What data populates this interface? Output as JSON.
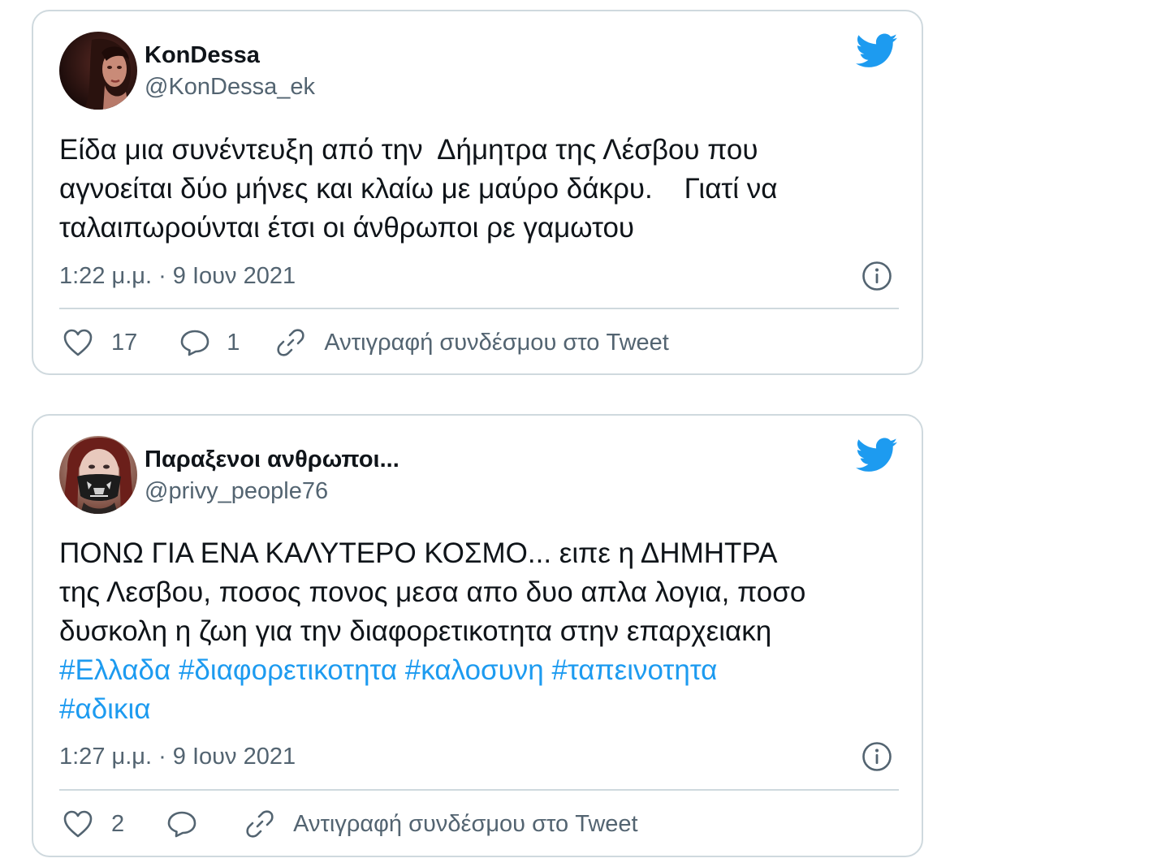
{
  "colors": {
    "text": "#0f1419",
    "secondary": "#536471",
    "hashtag": "#1d9bf0",
    "twitter_blue": "#1d9bf0",
    "border": "#cfd9de"
  },
  "tweets": [
    {
      "display_name": "KonDessa",
      "handle": "@KonDessa_ek",
      "text_lines": [
        "Είδα μια συνέντευξη από την  Δήμητρα της Λέσβου που",
        "αγνοείται δύο μήνες και κλαίω με μαύρο δάκρυ.    Γιατί να",
        "ταλαιπωρούνται έτσι οι άνθρωποι ρε γαμωτου"
      ],
      "timestamp": "1:22 μ.μ. · 9 Ιουν 2021",
      "like_count": "17",
      "reply_count": "1",
      "copy_link_label": "Αντιγραφή συνδέσμου στο Tweet",
      "icons": {
        "logo": "twitter-bird-icon",
        "info": "info-icon",
        "like": "heart-icon",
        "reply": "reply-bubble-icon",
        "copy": "link-icon"
      }
    },
    {
      "display_name": "Παραξενοι ανθρωποι...",
      "handle": "@privy_people76",
      "text_lines": [
        "ΠΟΝΩ ΓΙΑ ΕΝΑ ΚΑΛΥΤΕΡΟ ΚΟΣΜΟ... ειπε η ΔΗΜΗΤΡΑ",
        "της Λεσβου, ποσος πονος μεσα απο δυο απλα λογια, ποσο",
        "δυσκολη η ζωη για την διαφορετικοτητα στην επαρχειακη"
      ],
      "hashtags": [
        "#Ελλαδα",
        "#διαφορετικοτητα",
        "#καλοσυνη",
        "#ταπεινοτητα",
        "#αδικια"
      ],
      "timestamp": "1:27 μ.μ. · 9 Ιουν 2021",
      "like_count": "2",
      "copy_link_label": "Αντιγραφή συνδέσμου στο Tweet",
      "icons": {
        "logo": "twitter-bird-icon",
        "info": "info-icon",
        "like": "heart-icon",
        "reply": "reply-bubble-icon",
        "copy": "link-icon"
      }
    }
  ]
}
